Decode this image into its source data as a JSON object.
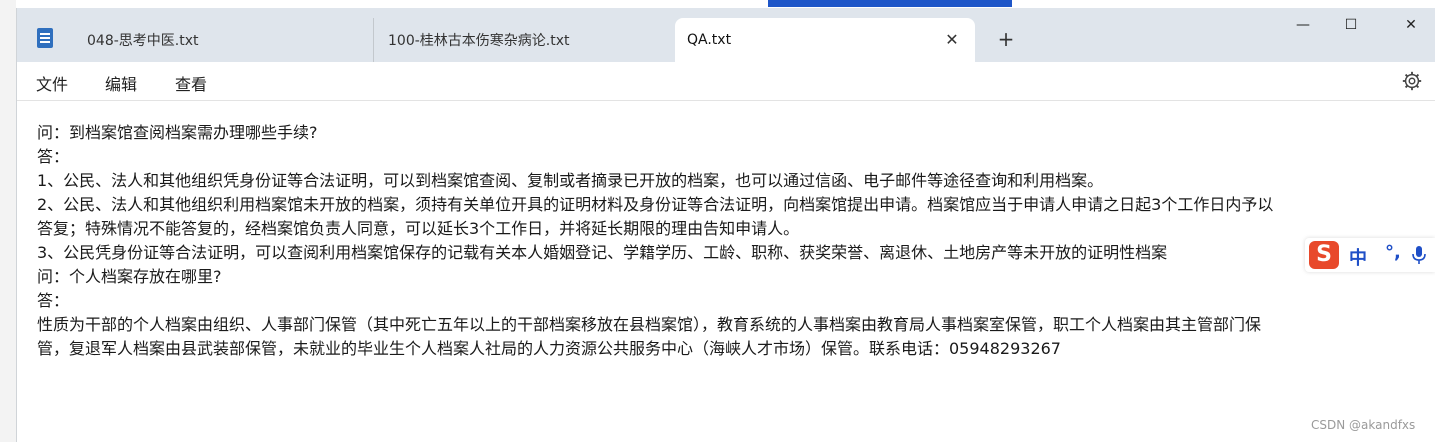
{
  "tabs": [
    {
      "label": "048-思考中医.txt"
    },
    {
      "label": "100-桂林古本伤寒杂病论.txt"
    },
    {
      "label": "QA.txt"
    }
  ],
  "tab_close_glyph": "✕",
  "new_tab_glyph": "+",
  "window_controls": {
    "minimize": "—",
    "maximize": "☐",
    "close": "✕"
  },
  "menu": {
    "file": "文件",
    "edit": "编辑",
    "view": "查看"
  },
  "editor": {
    "lines": [
      "问：到档案馆查阅档案需办理哪些手续?",
      "答：",
      "1、公民、法人和其他组织凭身份证等合法证明，可以到档案馆查阅、复制或者摘录已开放的档案，也可以通过信函、电子邮件等途径查询和利用档案。",
      "2、公民、法人和其他组织利用档案馆未开放的档案，须持有关单位开具的证明材料及身份证等合法证明，向档案馆提出申请。档案馆应当于申请人申请之日起3个工作日内予以",
      "答复；特殊情况不能答复的，经档案馆负责人同意，可以延长3个工作日，并将延长期限的理由告知申请人。",
      "3、公民凭身份证等合法证明，可以查阅利用档案馆保存的记载有关本人婚姻登记、学籍学历、工龄、职称、获奖荣誉、离退休、土地房产等未开放的证明性档案",
      "问：个人档案存放在哪里?",
      "答：",
      "性质为干部的个人档案由组织、人事部门保管（其中死亡五年以上的干部档案移放在县档案馆），教育系统的人事档案由教育局人事档案室保管，职工个人档案由其主管部门保",
      "管，复退军人档案由县武装部保管，未就业的毕业生个人档案人社局的人力资源公共服务中心（海峡人才市场）保管。联系电话：05948293267"
    ]
  },
  "ime": {
    "logo": "S",
    "mode": "中",
    "punct": "°,"
  },
  "watermark": "CSDN @akandfxs",
  "colors": {
    "ime_logo": "#e8492b",
    "ime_text": "#1f4fc7",
    "titlebar": "#dfe5ec"
  }
}
